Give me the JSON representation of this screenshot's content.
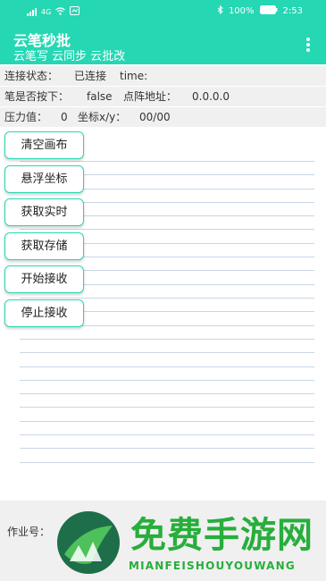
{
  "status_bar": {
    "network_label": "4G",
    "battery": "100%",
    "time": "2:53",
    "left_icons": [
      "signal-icon",
      "wifi-icon",
      "notification-icon"
    ],
    "right_icons": [
      "bluetooth-icon",
      "battery-icon"
    ]
  },
  "app": {
    "title": "云笔秒批",
    "subtitle": "云笔写 云同步 云批改",
    "menu_icon": "more-vert-icon",
    "accent_color": "#25d7b3"
  },
  "info": {
    "connection_label": "连接状态：",
    "connection_value": "已连接",
    "time_label": "time:",
    "pen_down_label": "笔是否按下：",
    "pen_down_value": "false",
    "address_label": "点阵地址：",
    "address_value": "0.0.0.0",
    "pressure_label": "压力值：",
    "pressure_value": "0",
    "coord_label": "坐标x/y：",
    "coord_value": "00/00"
  },
  "buttons": {
    "clear": "清空画布",
    "float": "悬浮坐标",
    "realtime": "获取实时",
    "stored": "获取存储",
    "start": "开始接收",
    "stop": "停止接收"
  },
  "bottom": {
    "homework_label": "作业号："
  },
  "watermark": {
    "text": "免费手游网",
    "sub": "MIANFEISHOUYOUWANG",
    "color": "#27ae3c"
  }
}
